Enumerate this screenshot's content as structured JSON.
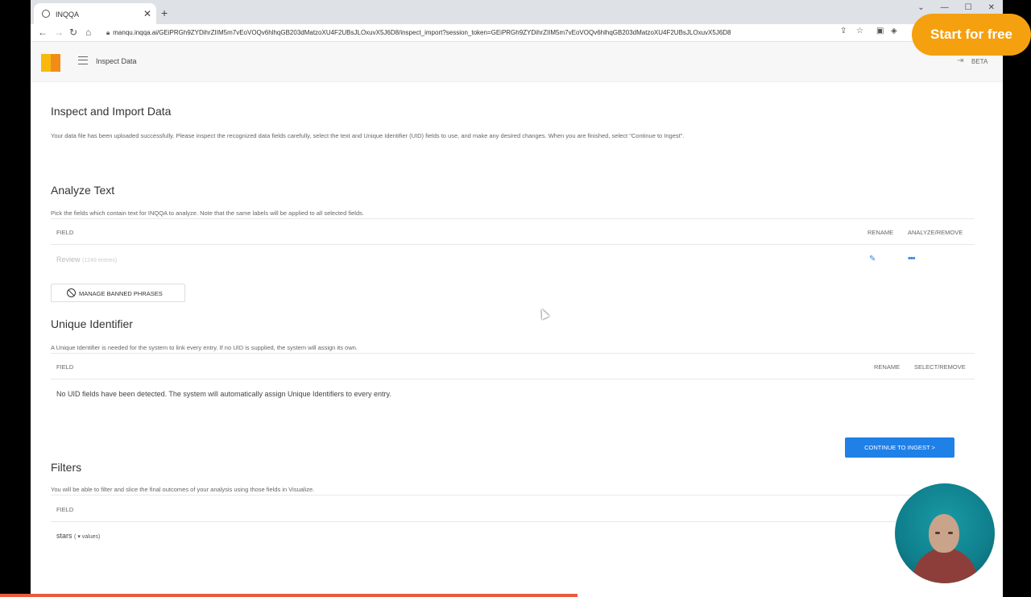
{
  "browser": {
    "tab_title": "INQQA",
    "new_tab": "+",
    "close_tab": "✕",
    "url": "manqu.inqqa.ai/GEiPRGh9ZYDihrZIIM5m7vEoVOQv6hlhqGB203dMatzoXU4F2UBsJLOxuvX5J6D8/inspect_import?session_token=GEiPRGh9ZYDihrZIIM5m7vEoVOQv6hlhqGB203dMatzoXU4F2UBsJLOxuvX5J6D8"
  },
  "overlay": {
    "start_for_free": "Start for free"
  },
  "appbar": {
    "title": "Inspect Data",
    "beta": "BETA"
  },
  "page": {
    "title": "Inspect and Import Data",
    "intro": "Your data file has been uploaded successfully. Please inspect the recognized data fields carefully, select the text and Unique Identifier (UID) fields to use, and make any desired changes. When you are finished, select \"Continue to Ingest\"."
  },
  "analyze_text": {
    "heading": "Analyze Text",
    "description": "Pick the fields which contain text for INQQA to analyze. Note that the same labels will be applied to all selected fields.",
    "col_field": "FIELD",
    "col_rename": "RENAME",
    "col_action": "ANALYZE/REMOVE",
    "rows": [
      {
        "name": "Review",
        "count": "(1249 entries)"
      }
    ],
    "banned_button": "MANAGE BANNED PHRASES"
  },
  "uid": {
    "heading": "Unique Identifier",
    "description": "A Unique Identifier is needed for the system to link every entry. If no UID is supplied, the system will assign its own.",
    "col_field": "FIELD",
    "col_rename": "RENAME",
    "col_action": "SELECT/REMOVE",
    "empty_message": "No UID fields have been detected. The system will automatically assign Unique Identifiers to every entry."
  },
  "continue_button": "CONTINUE TO INGEST >",
  "filters": {
    "heading": "Filters",
    "description": "You will be able to filter and slice the final outcomes of your analysis using those fields in Visualize.",
    "col_field": "FIELD",
    "rows": [
      {
        "name": "stars",
        "values_label": "values"
      }
    ]
  },
  "colors": {
    "accent": "#1f80e8",
    "start_for_free_bg": "#f5a00f",
    "logo_left": "#f8b90c",
    "logo_right": "#f28c18"
  },
  "progress": 0.56
}
